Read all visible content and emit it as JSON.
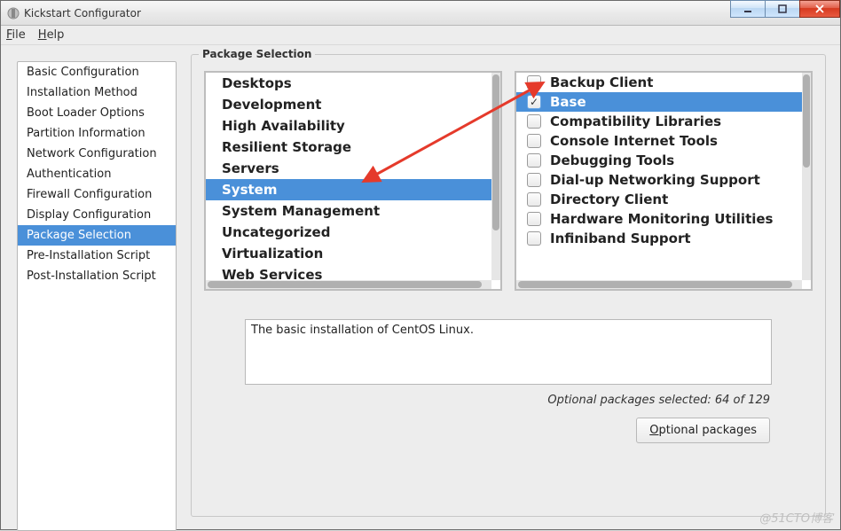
{
  "window": {
    "title": "Kickstart Configurator"
  },
  "menubar": {
    "file": "File",
    "help": "Help"
  },
  "sidebar": {
    "items": [
      {
        "label": "Basic Configuration"
      },
      {
        "label": "Installation Method"
      },
      {
        "label": "Boot Loader Options"
      },
      {
        "label": "Partition Information"
      },
      {
        "label": "Network Configuration"
      },
      {
        "label": "Authentication"
      },
      {
        "label": "Firewall Configuration"
      },
      {
        "label": "Display Configuration"
      },
      {
        "label": "Package Selection"
      },
      {
        "label": "Pre-Installation Script"
      },
      {
        "label": "Post-Installation Script"
      }
    ],
    "selected_index": 8
  },
  "fieldset": {
    "legend": "Package Selection"
  },
  "categories": {
    "items": [
      {
        "label": "Desktops"
      },
      {
        "label": "Development"
      },
      {
        "label": "High Availability"
      },
      {
        "label": "Resilient Storage"
      },
      {
        "label": "Servers"
      },
      {
        "label": "System"
      },
      {
        "label": "System Management"
      },
      {
        "label": "Uncategorized"
      },
      {
        "label": "Virtualization"
      },
      {
        "label": "Web Services"
      }
    ],
    "selected_index": 5
  },
  "packages": {
    "items": [
      {
        "label": "Backup Client",
        "checked": false
      },
      {
        "label": "Base",
        "checked": true
      },
      {
        "label": "Compatibility Libraries",
        "checked": false
      },
      {
        "label": "Console Internet Tools",
        "checked": false
      },
      {
        "label": "Debugging Tools",
        "checked": false
      },
      {
        "label": "Dial-up Networking Support",
        "checked": false
      },
      {
        "label": "Directory Client",
        "checked": false
      },
      {
        "label": "Hardware Monitoring Utilities",
        "checked": false
      },
      {
        "label": "Infiniband Support",
        "checked": false
      }
    ],
    "selected_index": 1
  },
  "description": "The basic installation of CentOS Linux.",
  "status": "Optional packages selected: 64 of 129",
  "button": {
    "optional": "Optional packages"
  },
  "watermark": "@51CTO博客"
}
